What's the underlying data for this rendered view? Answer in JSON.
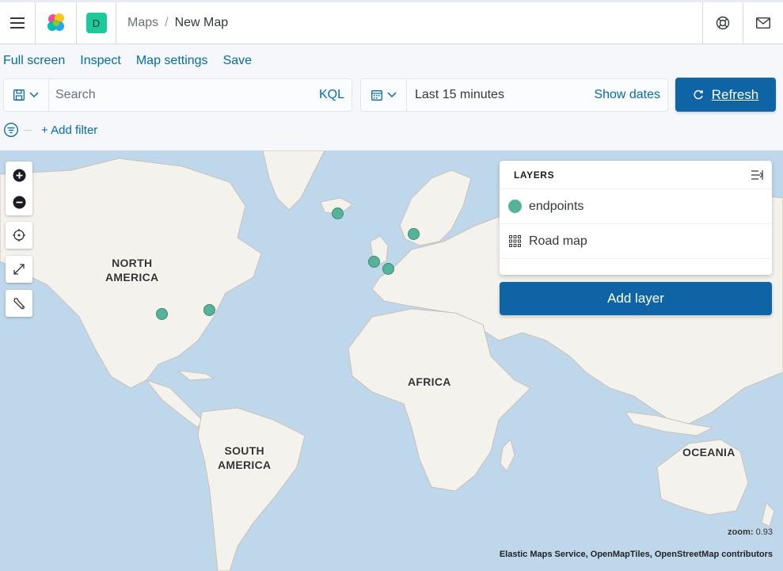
{
  "header": {
    "menu_icon": "hamburger-icon",
    "logo_icon": "elastic-logo-icon",
    "space_initial": "D",
    "breadcrumb_parent": "Maps",
    "breadcrumb_separator": "/",
    "breadcrumb_current": "New Map",
    "help_icon": "lifebuoy-icon",
    "mail_icon": "mail-icon"
  },
  "topnav": {
    "links": [
      "Full screen",
      "Inspect",
      "Map settings",
      "Save"
    ]
  },
  "query": {
    "placeholder": "Search",
    "language": "KQL"
  },
  "time": {
    "range": "Last 15 minutes",
    "show_dates": "Show dates",
    "refresh": "Refresh"
  },
  "filter": {
    "add_filter": "+ Add filter"
  },
  "map": {
    "labels": {
      "north_america_1": "NORTH",
      "north_america_2": "AMERICA",
      "south_america_1": "SOUTH",
      "south_america_2": "AMERICA",
      "africa": "AFRICA",
      "oceania": "OCEANIA"
    },
    "zoom_label": "zoom:",
    "zoom_value": "0.93",
    "attribution": "Elastic Maps Service, OpenMapTiles, OpenStreetMap contributors",
    "point_color": "#54b399"
  },
  "layers": {
    "title": "LAYERS",
    "items": [
      {
        "name": "endpoints",
        "icon": "green-circle-icon"
      },
      {
        "name": "Road map",
        "icon": "grid-icon"
      }
    ],
    "add_layer": "Add layer"
  }
}
